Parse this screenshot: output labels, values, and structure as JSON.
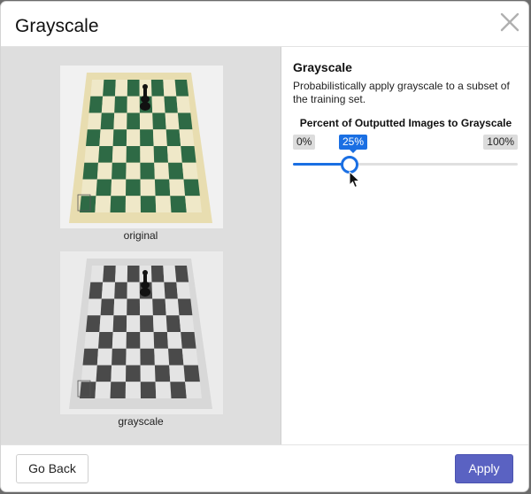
{
  "modal": {
    "title": "Grayscale",
    "close_icon": "close-icon"
  },
  "preview": {
    "original_caption": "original",
    "grayscale_caption": "grayscale"
  },
  "settings": {
    "title": "Grayscale",
    "description": "Probabilistically apply grayscale to a subset of the training set.",
    "slider_label": "Percent of Outputted Images to Grayscale",
    "min_label": "0%",
    "max_label": "100%",
    "value_label": "25%",
    "value_percent": 25
  },
  "footer": {
    "back_label": "Go Back",
    "apply_label": "Apply"
  },
  "colors": {
    "accent": "#1a6fe3",
    "apply_button": "#5a62c2",
    "board_green": "#2e6a45",
    "board_cream": "#efe8c8",
    "board_dark_gray": "#4a4a4a",
    "board_light_gray": "#e4e4e4"
  }
}
